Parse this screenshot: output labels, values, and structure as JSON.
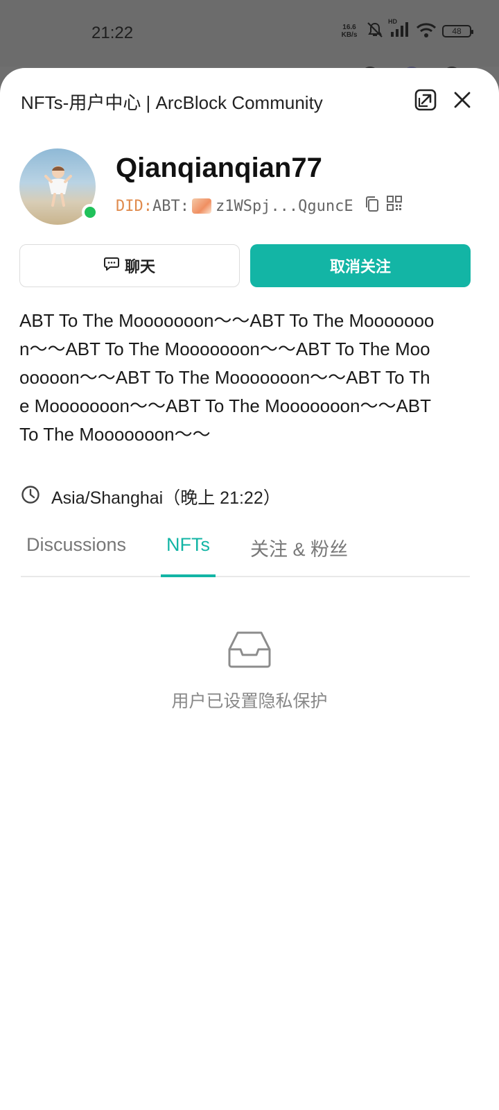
{
  "status_bar": {
    "time": "21:22",
    "net_speed_value": "16.6",
    "net_speed_unit": "KB/s",
    "signal_label": "HD",
    "battery": "48"
  },
  "sheet": {
    "title": "NFTs-用户中心 | ArcBlock Community"
  },
  "profile": {
    "username": "Qianqianqian77",
    "did_prefix": "DID:",
    "did_chain": "ABT:",
    "did_short": "z1WSpj...QguncE",
    "online_color": "#20c15a"
  },
  "actions": {
    "chat_label": "聊天",
    "unfollow_label": "取消关注",
    "accent_color": "#13b5a5"
  },
  "bio": "ABT To The Mooooooon～～ABT To The Mooooooon～～ABT To The Mooooooon～～ABT To The Mooooooon～～ABT To The Mooooooon～～ABT To The Mooooooon～～ABT To The Mooooooon～～ABT To The Mooooooon～～",
  "timezone": "Asia/Shanghai（晚上 21:22）",
  "tabs": [
    {
      "label": "Discussions",
      "active": false
    },
    {
      "label": "NFTs",
      "active": true
    },
    {
      "label": "关注 & 粉丝",
      "active": false
    }
  ],
  "empty_state": {
    "icon": "inbox-icon",
    "text": "用户已设置隐私保护"
  }
}
